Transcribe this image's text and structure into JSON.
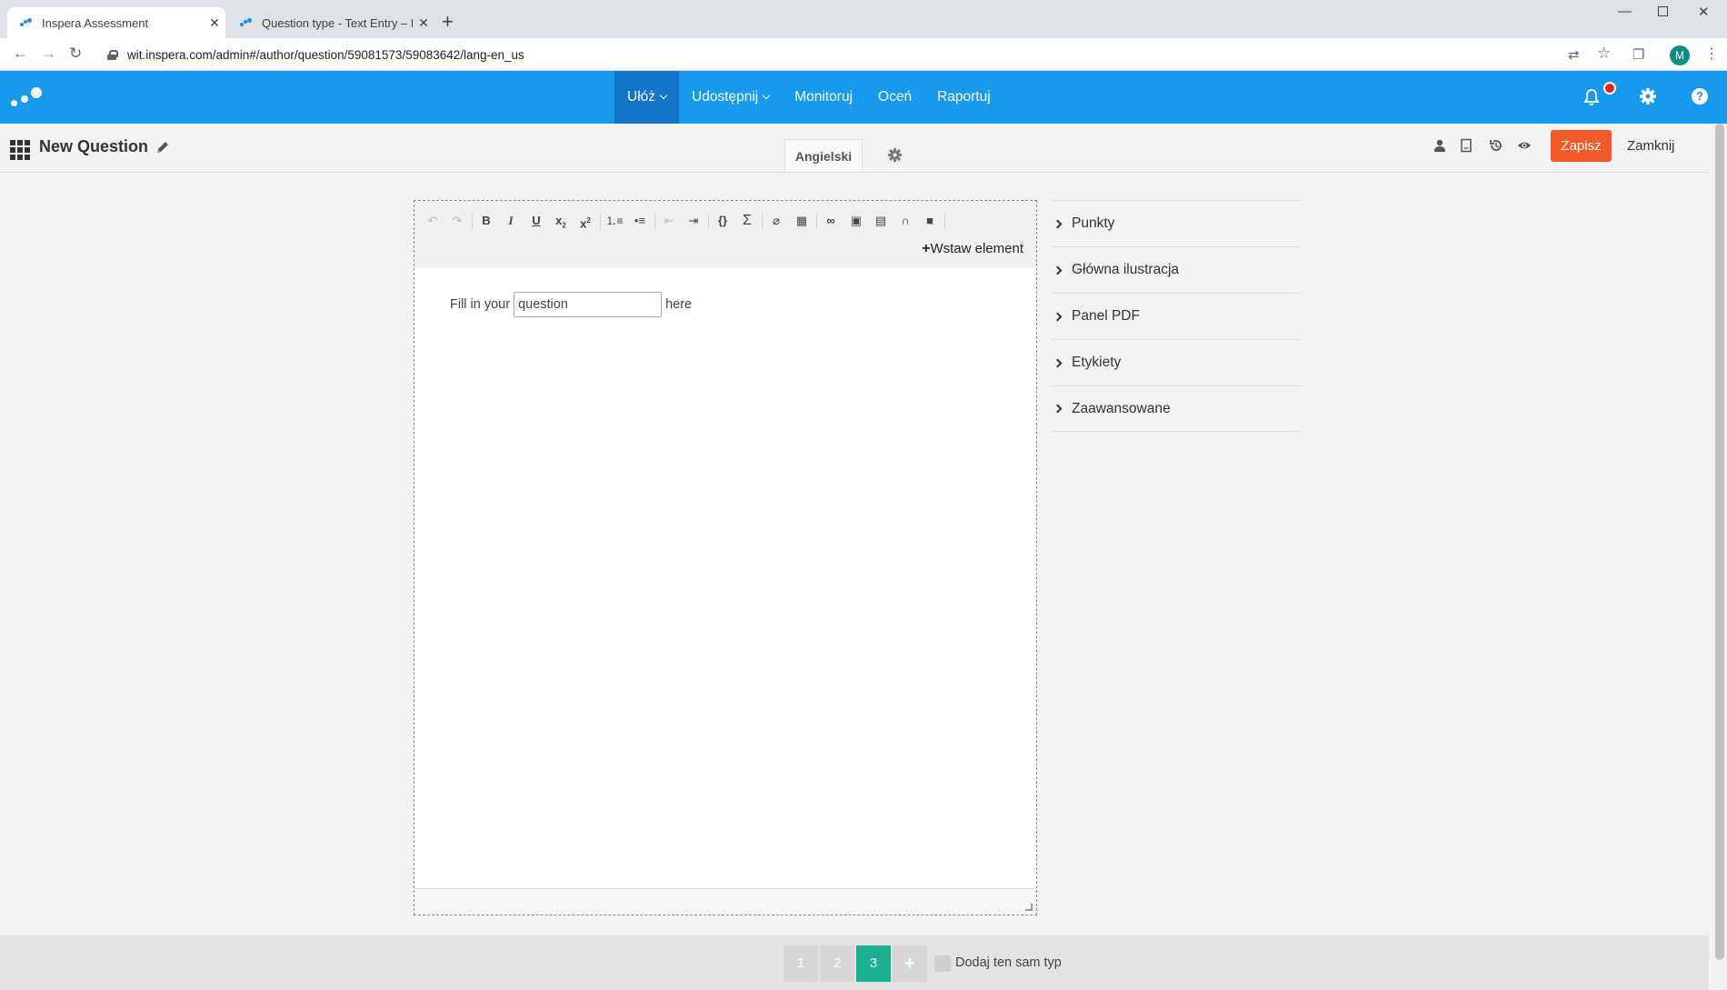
{
  "browser": {
    "tabs": [
      {
        "title": "Inspera Assessment"
      },
      {
        "title": "Question type - Text Entry – Insp"
      }
    ],
    "url": "wit.inspera.com/admin#/author/question/59081573/59083642/lang-en_us",
    "profile_initial": "M"
  },
  "nav": {
    "items": [
      {
        "label": "Ułóż"
      },
      {
        "label": "Udostępnij"
      },
      {
        "label": "Monitoruj"
      },
      {
        "label": "Oceń"
      },
      {
        "label": "Raportuj"
      }
    ],
    "help_label": "?"
  },
  "subheader": {
    "title": "New Question",
    "language_tab": "Angielski",
    "save_label": "Zapisz",
    "close_label": "Zamknij"
  },
  "editor": {
    "insert_element_label": "Wstaw element",
    "text_before": "Fill in your",
    "gap_value": "question",
    "text_after": "here"
  },
  "side_panel": {
    "items": [
      {
        "label": "Punkty"
      },
      {
        "label": "Główna ilustracja"
      },
      {
        "label": "Panel PDF"
      },
      {
        "label": "Etykiety"
      },
      {
        "label": "Zaawansowane"
      }
    ]
  },
  "footer": {
    "pages": [
      "1",
      "2",
      "3"
    ],
    "active_page": "3",
    "add_same_type_label": "Dodaj ten sam typ"
  },
  "colors": {
    "header_blue": "#1799ee",
    "active_nav": "#1275c8",
    "save_orange": "#f45a28",
    "active_page_green": "#1ab08f",
    "notification_red": "#e3222a"
  }
}
